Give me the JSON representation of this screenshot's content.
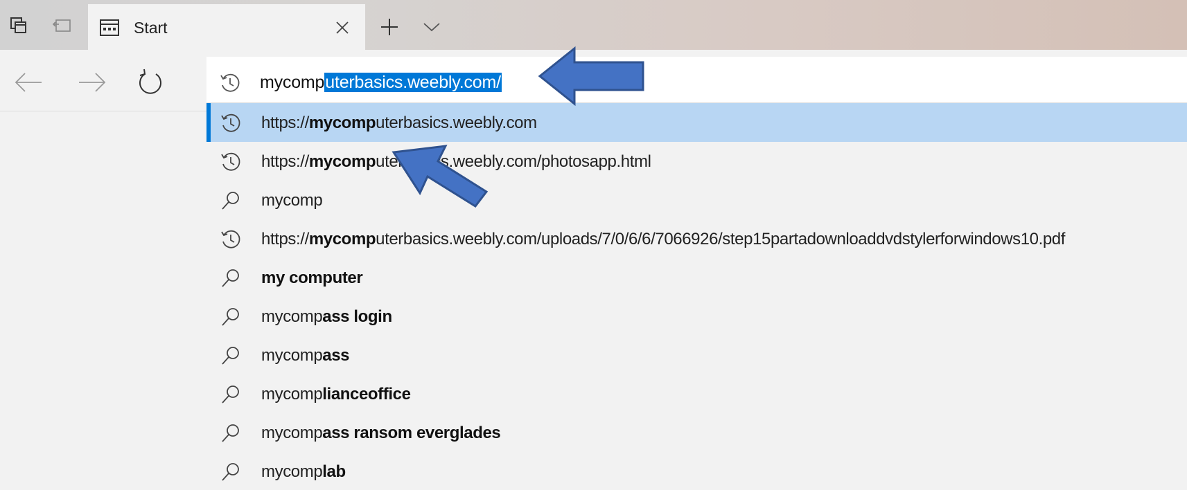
{
  "tabbar": {
    "active_tab": {
      "title": "Start"
    }
  },
  "address": {
    "typed": "mycomp",
    "autocompleted": "uterbasics.weebly.com/"
  },
  "suggestions": [
    {
      "type": "history",
      "prefix": "https://",
      "bold": "mycomp",
      "suffix": "uterbasics.weebly.com",
      "selected": true
    },
    {
      "type": "history",
      "prefix": "https://",
      "bold": "mycomp",
      "suffix": "uterbasics.weebly.com/photosapp.html",
      "selected": false
    },
    {
      "type": "search",
      "prefix": "mycomp",
      "bold": "",
      "suffix": "",
      "selected": false
    },
    {
      "type": "history",
      "prefix": "https://",
      "bold": "mycomp",
      "suffix": "uterbasics.weebly.com/uploads/7/0/6/6/7066926/step15partadownloaddvdstylerforwindows10.pdf",
      "selected": false
    },
    {
      "type": "search",
      "prefix": "",
      "bold": "my computer",
      "suffix": "",
      "selected": false
    },
    {
      "type": "search",
      "prefix": "mycomp",
      "bold": "ass login",
      "suffix": "",
      "selected": false
    },
    {
      "type": "search",
      "prefix": "mycomp",
      "bold": "ass",
      "suffix": "",
      "selected": false
    },
    {
      "type": "search",
      "prefix": "mycomp",
      "bold": "lianceoffice",
      "suffix": "",
      "selected": false
    },
    {
      "type": "search",
      "prefix": "mycomp",
      "bold": "ass ransom everglades",
      "suffix": "",
      "selected": false
    },
    {
      "type": "search",
      "prefix": "mycomp",
      "bold": "lab",
      "suffix": "",
      "selected": false
    }
  ],
  "icons": {
    "history": "history-icon",
    "search": "search-icon"
  },
  "colors": {
    "selection": "#0078d7",
    "selected_row": "#b8d6f3",
    "arrow_fill": "#4472c4",
    "arrow_stroke": "#2f528f"
  }
}
